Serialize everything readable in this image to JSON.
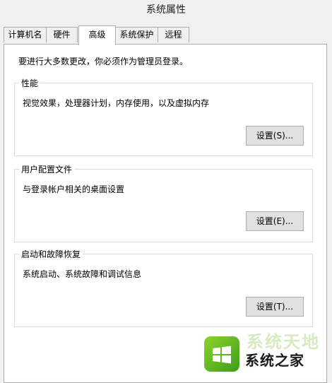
{
  "window": {
    "title": "系统属性"
  },
  "tabs": [
    {
      "label": "计算机名"
    },
    {
      "label": "硬件"
    },
    {
      "label": "高级",
      "active": true
    },
    {
      "label": "系统保护"
    },
    {
      "label": "远程"
    }
  ],
  "advanced": {
    "notice": "要进行大多数更改，你必须作为管理员登录。",
    "groups": [
      {
        "title": "性能",
        "description": "视觉效果，处理器计划，内存使用，以及虚拟内存",
        "button_label": "设置(S)..."
      },
      {
        "title": "用户配置文件",
        "description": "与登录帐户相关的桌面设置",
        "button_label": "设置(E)..."
      },
      {
        "title": "启动和故障恢复",
        "description": "系统启动、系统故障和调试信息",
        "button_label": "设置(T)..."
      }
    ]
  },
  "watermark": {
    "brand": "系统之家",
    "faded_text": "系统天地",
    "icon": "windows-logo-icon"
  },
  "colors": {
    "window_bg": "#f0f0f0",
    "panel_bg": "#ffffff",
    "button_bg": "#e1e1e1",
    "border": "#adadad",
    "watermark_green": "#3c9d18"
  }
}
